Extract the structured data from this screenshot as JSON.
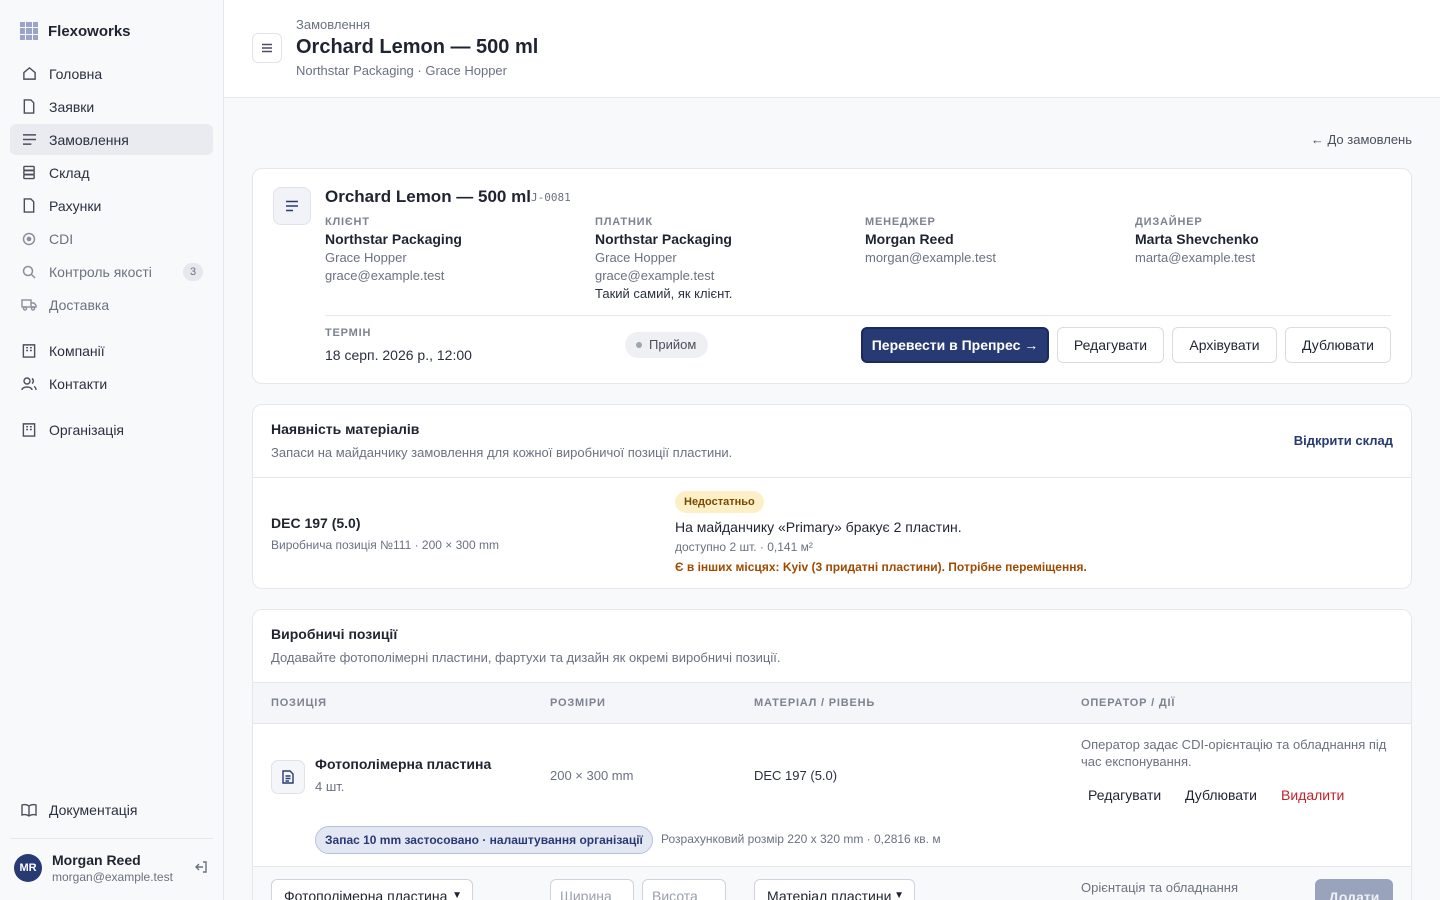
{
  "app": {
    "name": "Flexoworks"
  },
  "sidebar": {
    "items": [
      {
        "label": "Головна"
      },
      {
        "label": "Заявки"
      },
      {
        "label": "Замовлення"
      },
      {
        "label": "Склад"
      },
      {
        "label": "Рахунки"
      },
      {
        "label": "CDI"
      },
      {
        "label": "Контроль якості",
        "count": "3"
      },
      {
        "label": "Доставка"
      },
      {
        "label": "Компанії"
      },
      {
        "label": "Контакти"
      },
      {
        "label": "Організація"
      }
    ],
    "docs": "Документація",
    "user": {
      "initials": "MR",
      "name": "Morgan Reed",
      "email": "morgan@example.test"
    }
  },
  "header": {
    "crumb": "Замовлення",
    "title": "Orchard Lemon — 500 ml",
    "subtitle": "Northstar Packaging · Grace Hopper"
  },
  "back_link": "← До замовлень",
  "order": {
    "title": "Orchard Lemon — 500 ml",
    "code": "J-0081",
    "client": {
      "label": "КЛІЄНТ",
      "company": "Northstar Packaging",
      "contact": "Grace Hopper",
      "email": "grace@example.test"
    },
    "payer": {
      "label": "ПЛАТНИК",
      "company": "Northstar Packaging",
      "contact": "Grace Hopper",
      "email": "grace@example.test",
      "note": "Такий самий, як клієнт."
    },
    "manager": {
      "label": "МЕНЕДЖЕР",
      "name": "Morgan Reed",
      "email": "morgan@example.test"
    },
    "designer": {
      "label": "ДИЗАЙНЕР",
      "name": "Marta Shevchenko",
      "email": "marta@example.test"
    },
    "term": {
      "label": "ТЕРМІН",
      "value": "18 серп. 2026 р., 12:00"
    },
    "status": "Прийом",
    "actions": {
      "transfer": "Перевести в Препрес →",
      "edit": "Редагувати",
      "archive": "Архівувати",
      "duplicate": "Дублювати"
    }
  },
  "materials": {
    "title": "Наявність матеріалів",
    "subtitle": "Запаси на майданчику замовлення для кожної виробничої позиції пластини.",
    "open_stock": "Відкрити склад",
    "item": {
      "name": "DEC 197 (5.0)",
      "position": "Виробнича позиція №111 · 200 × 300 mm",
      "badge": "Недостатньо",
      "message": "На майданчику «Primary» бракує 2 пластин.",
      "available": "доступно 2 шт. · 0,141 м²",
      "elsewhere": "Є в інших місцях: Kyiv (3 придатні пластини). Потрібне переміщення."
    }
  },
  "production": {
    "title": "Виробничі позиції",
    "subtitle": "Додавайте фотополімерні пластини, фартухи та дизайн як окремі виробничі позиції.",
    "columns": [
      "ПОЗИЦІЯ",
      "РОЗМІРИ",
      "МАТЕРІАЛ / РІВЕНЬ",
      "ОПЕРАТОР / ДІЇ"
    ],
    "row": {
      "name": "Фотополімерна пластина",
      "qty": "4 шт.",
      "size": "200 × 300 mm",
      "material": "DEC 197 (5.0)",
      "note": "Оператор задає CDI-орієнтацію та обладнання під час експонування.",
      "edit": "Редагувати",
      "duplicate": "Дублювати",
      "delete": "Видалити",
      "margin_chip": "Запас 10 mm застосовано · налаштування організації",
      "calc_size": "Розрахунковий розмір 220 x 320 mm · 0,2816 кв. м"
    },
    "add": {
      "type_value": "Фотополімерна пластина",
      "width_placeholder": "Ширина",
      "height_placeholder": "Висота",
      "material_value": "Матеріал пластини",
      "orientation_note": "Орієнтація та обладнання",
      "add_button": "Додати"
    }
  }
}
